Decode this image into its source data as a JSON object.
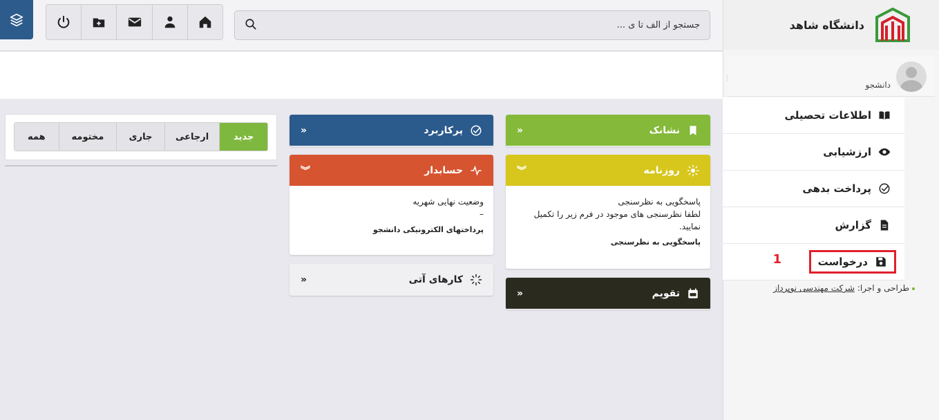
{
  "brand": {
    "name": "دانشگاه شاهد"
  },
  "user": {
    "role": "دانشجو"
  },
  "nav": {
    "items": [
      {
        "label": "اطلاعات تحصیلی",
        "icon": "book-icon"
      },
      {
        "label": "ارزشیابی",
        "icon": "eye-icon"
      },
      {
        "label": "پرداخت بدهی",
        "icon": "check-circle-icon"
      },
      {
        "label": "گزارش",
        "icon": "document-icon"
      },
      {
        "label": "درخواست",
        "icon": "save-icon"
      }
    ],
    "highlight_number": "1"
  },
  "credit": {
    "prefix": "طراحی و اجرا:",
    "company": "شرکت مهندسی نوپرداز"
  },
  "search": {
    "placeholder": "جستجو از الف تا ی ..."
  },
  "widgets": {
    "neshanak": {
      "title": "نشانک",
      "color": "#84b93a"
    },
    "rooznameh": {
      "title": "روزنامه",
      "color": "#d7c61c",
      "line1": "پاسخگویی به نظرسنجی",
      "line2": "لطفا نظرسنجی های موجود در فرم زیر را تکمیل نمایید.",
      "link": "پاسخگویی به نظرسنجی"
    },
    "taghvim": {
      "title": "تقویم",
      "color": "#2a2a1e"
    },
    "porkarbord": {
      "title": "پرکاربرد",
      "color": "#2b5a8c"
    },
    "hesabdar": {
      "title": "حسابدار",
      "color": "#d65430",
      "line1": "وضعیت نهایی شهریه",
      "line2": "–",
      "link": "پرداختهای الکترونیکی دانشجو"
    },
    "karha": {
      "title": "کارهای آتی"
    }
  },
  "tabs": [
    "جدید",
    "ارجاعی",
    "جاری",
    "مختومه",
    "همه"
  ],
  "active_tab": "جدید"
}
